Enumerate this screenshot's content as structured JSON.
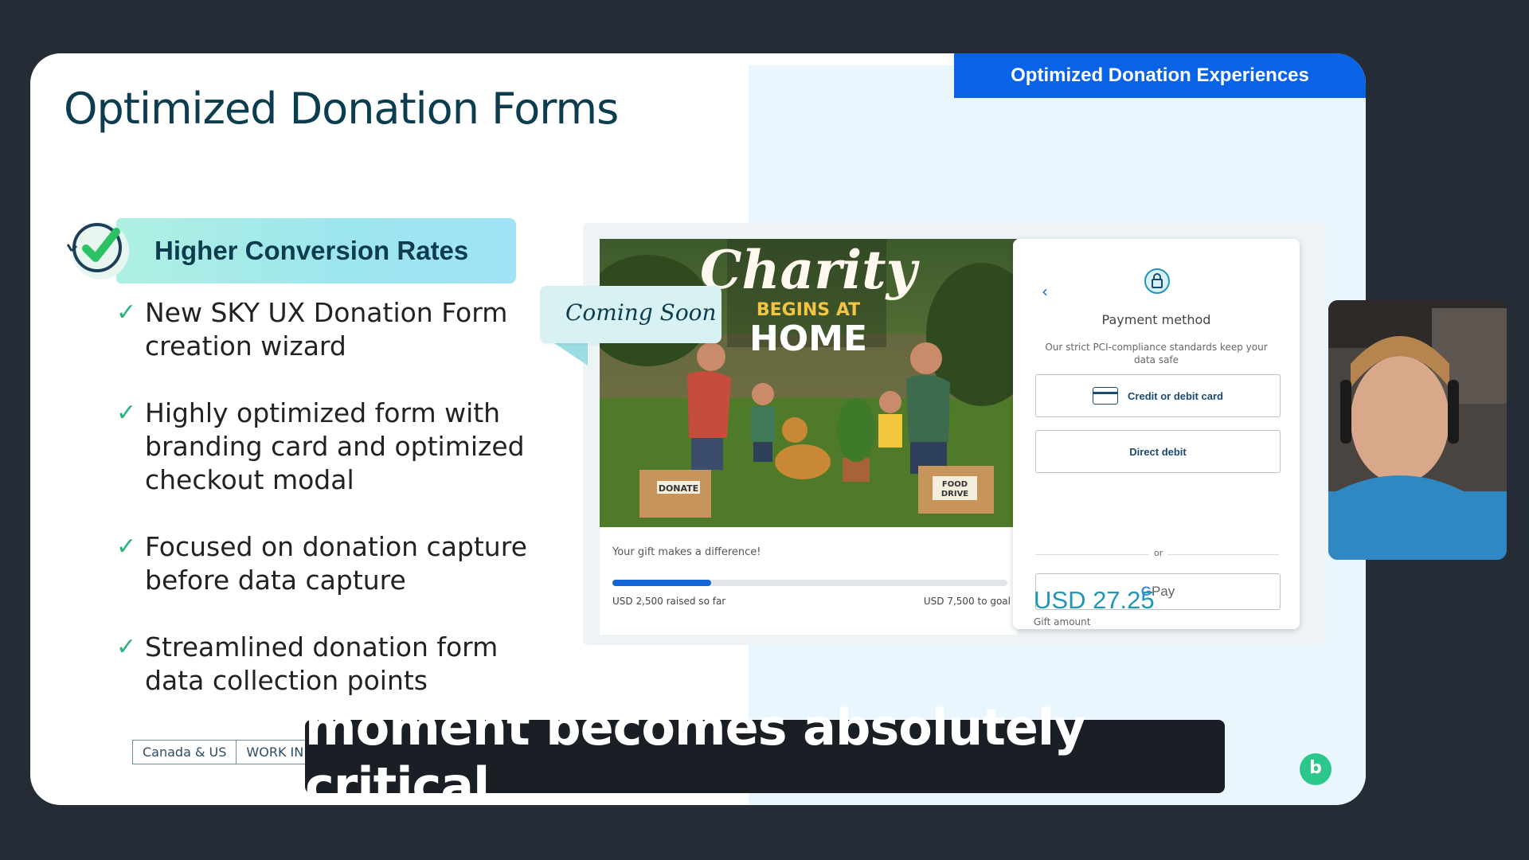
{
  "slide": {
    "tab_label": "Optimized Donation Experiences",
    "title": "Optimized Donation Forms",
    "banner_label": "Higher Conversion Rates",
    "bullets": [
      "New  SKY UX Donation Form creation wizard",
      "Highly optimized form with branding card and optimized checkout modal",
      "Focused on donation capture before data capture",
      "Streamlined donation form data collection points"
    ],
    "footer_tags": [
      "Canada & US",
      "WORK IN"
    ],
    "coming_soon": "Coming Soon"
  },
  "mockup": {
    "photo": {
      "headline": "Charity",
      "subline": "BEGINS AT",
      "headline2": "HOME",
      "box_left": "DONATE",
      "box_right_1": "FOOD",
      "box_right_2": "DRIVE"
    },
    "progress": {
      "gift_text": "Your gift makes a difference!",
      "raised_label": "USD 2,500 raised so far",
      "goal_label": "USD 7,500 to goal",
      "fraction": 0.25
    },
    "payment": {
      "title": "Payment method",
      "subtitle": "Our strict PCI-compliance standards keep your data safe",
      "card_option": "Credit or debit card",
      "debit_option": "Direct debit",
      "or_text": "or",
      "gpay_g": "G",
      "gpay_text": "Pay",
      "amount": "USD 27.25",
      "amount_label": "Gift amount"
    }
  },
  "caption": "moment becomes absolutely critical.",
  "brand_logo": "b",
  "colors": {
    "accent_blue": "#0a63e6",
    "title_teal": "#0c3d4f",
    "check_green": "#2fb37a",
    "amount_teal": "#1f97b6"
  }
}
